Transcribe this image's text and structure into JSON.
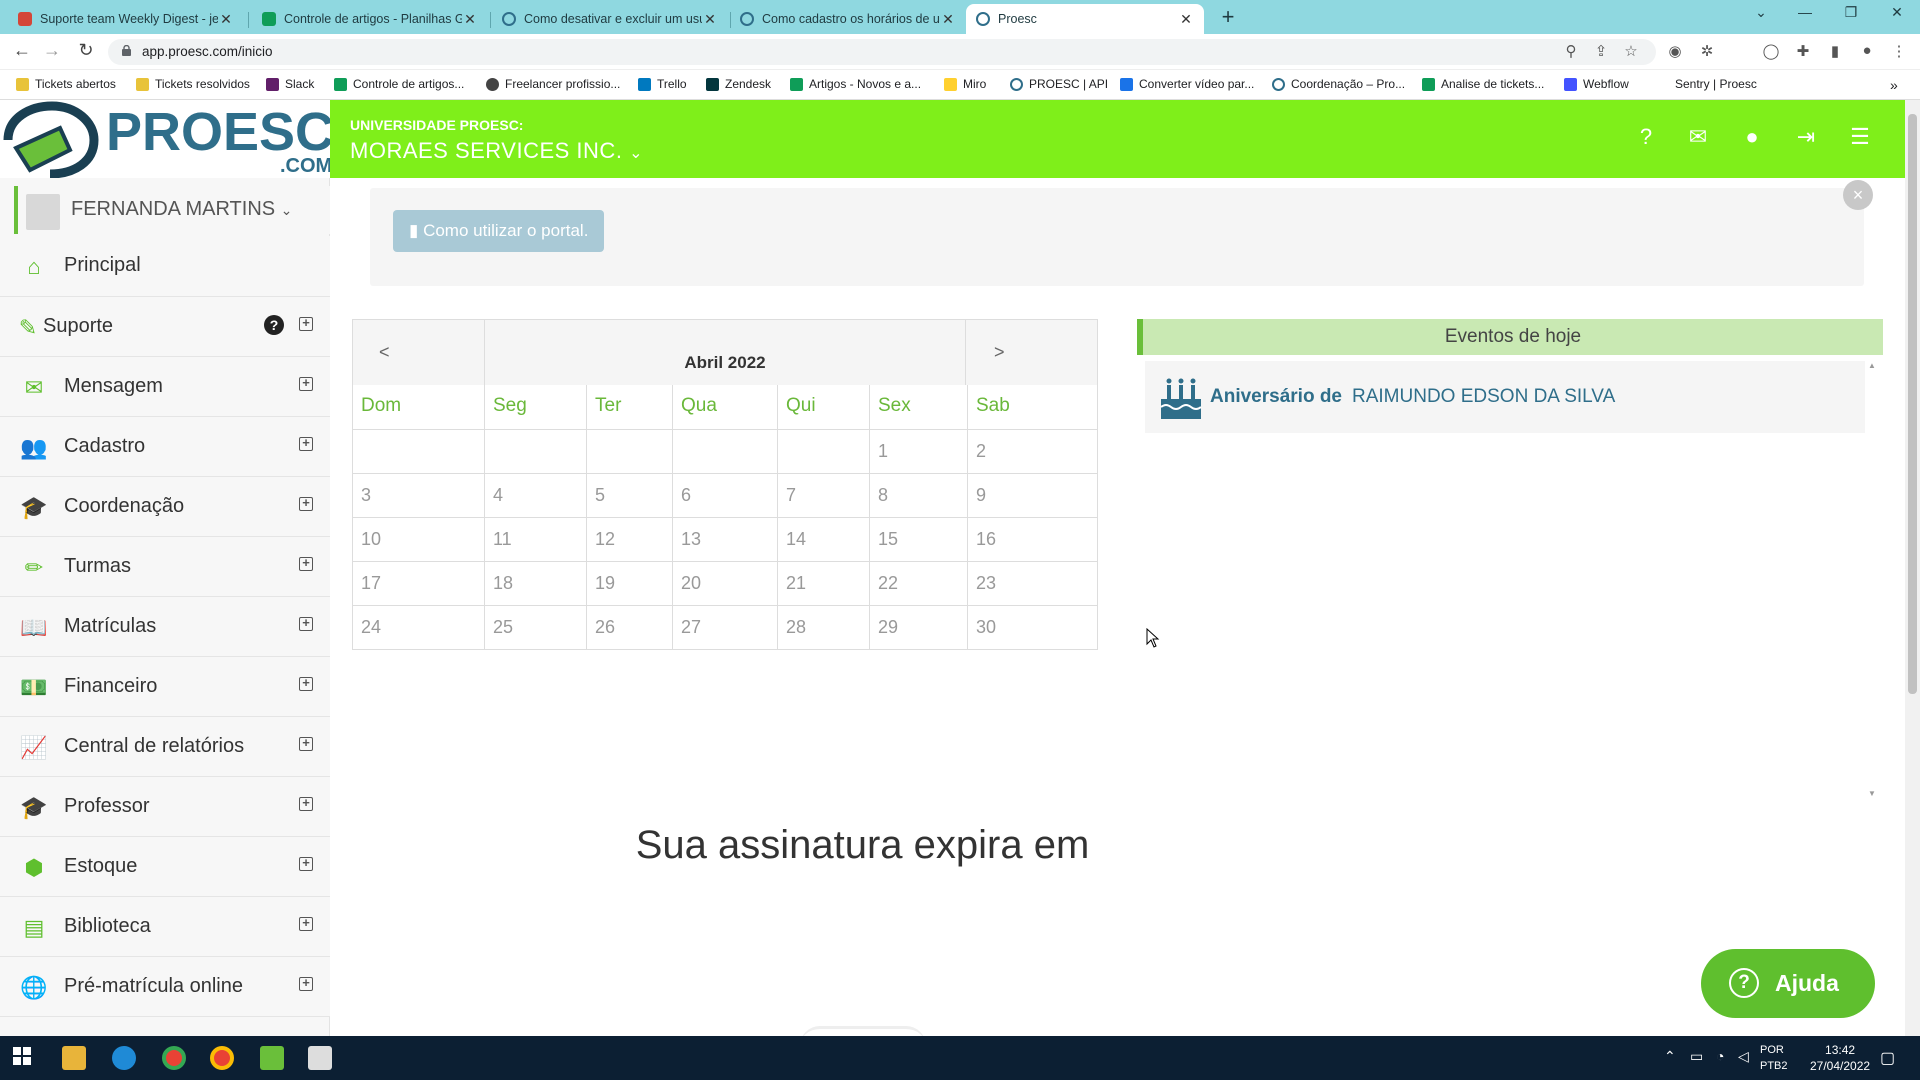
{
  "browser": {
    "tabs": [
      {
        "title": "Suporte team Weekly Digest - je",
        "favicon": "gmail-icon",
        "color": "#d44638"
      },
      {
        "title": "Controle de artigos - Planilhas G",
        "favicon": "sheets-icon",
        "color": "#0f9d58"
      },
      {
        "title": "Como desativar e excluir um usu",
        "favicon": "proesc-icon",
        "color": "#2f6e8a"
      },
      {
        "title": "Como cadastro os horários de ur",
        "favicon": "proesc-icon",
        "color": "#2f6e8a"
      },
      {
        "title": "Proesc",
        "favicon": "proesc-icon",
        "color": "#2f6e8a",
        "active": true
      }
    ],
    "new_tab": "+",
    "url": "app.proesc.com/inicio",
    "bookmarks": [
      {
        "label": "Tickets abertos",
        "color": "#e8c33a"
      },
      {
        "label": "Tickets resolvidos",
        "color": "#e8c33a"
      },
      {
        "label": "Slack",
        "color": "#611f69"
      },
      {
        "label": "Controle de artigos...",
        "color": "#0f9d58"
      },
      {
        "label": "Freelancer profissio...",
        "color": "#444"
      },
      {
        "label": "Trello",
        "color": "#0079bf"
      },
      {
        "label": "Zendesk",
        "color": "#03363d"
      },
      {
        "label": "Artigos - Novos e a...",
        "color": "#0f9d58"
      },
      {
        "label": "Miro",
        "color": "#ffd02f"
      },
      {
        "label": "PROESC | API",
        "color": "#2f6e8a"
      },
      {
        "label": "Converter vídeo par...",
        "color": "#1a73e8"
      },
      {
        "label": "Coordenação – Pro...",
        "color": "#2f6e8a"
      },
      {
        "label": "Analise de tickets...",
        "color": "#0f9d58"
      },
      {
        "label": "Webflow",
        "color": "#4353ff"
      },
      {
        "label": "Sentry | Proesc",
        "color": "#ffffff"
      }
    ]
  },
  "header": {
    "logo_text": "PROESC",
    "logo_suffix": ".COM",
    "university_label": "UNIVERSIDADE PROESC:",
    "company": "MORAES SERVICES INC.",
    "accent": "#7fef1a"
  },
  "sidebar": {
    "user": "FERNANDA MARTINS",
    "items": [
      {
        "label": "Principal",
        "icon": "home-icon",
        "expand": false
      },
      {
        "label": "Suporte",
        "icon": "ticket-icon",
        "expand": true,
        "help": true
      },
      {
        "label": "Mensagem",
        "icon": "envelope-icon",
        "expand": true
      },
      {
        "label": "Cadastro",
        "icon": "users-icon",
        "expand": true
      },
      {
        "label": "Coordenação",
        "icon": "graduation-cap-icon",
        "expand": true
      },
      {
        "label": "Turmas",
        "icon": "pencil-icon",
        "expand": true
      },
      {
        "label": "Matrículas",
        "icon": "book-icon",
        "expand": true
      },
      {
        "label": "Financeiro",
        "icon": "money-icon",
        "expand": true
      },
      {
        "label": "Central de relatórios",
        "icon": "chart-line-icon",
        "expand": true
      },
      {
        "label": "Professor",
        "icon": "graduation-cap-icon",
        "expand": true
      },
      {
        "label": "Estoque",
        "icon": "cube-icon",
        "expand": true
      },
      {
        "label": "Biblioteca",
        "icon": "archive-icon",
        "expand": true
      },
      {
        "label": "Pré-matrícula online",
        "icon": "globe-icon",
        "expand": true
      }
    ]
  },
  "notice": {
    "button_label": "Como utilizar o portal.",
    "close": "×"
  },
  "calendar": {
    "month": "Abril 2022",
    "prev": "<",
    "next": ">",
    "weekdays": [
      "Dom",
      "Seg",
      "Ter",
      "Qua",
      "Qui",
      "Sex",
      "Sab"
    ],
    "weeks": [
      [
        "",
        "",
        "",
        "",
        "",
        "1",
        "2"
      ],
      [
        "3",
        "4",
        "5",
        "6",
        "7",
        "8",
        "9"
      ],
      [
        "10",
        "11",
        "12",
        "13",
        "14",
        "15",
        "16"
      ],
      [
        "17",
        "18",
        "19",
        "20",
        "21",
        "22",
        "23"
      ],
      [
        "24",
        "25",
        "26",
        "27",
        "28",
        "29",
        "30"
      ]
    ]
  },
  "events": {
    "heading": "Eventos de hoje",
    "items": [
      {
        "prefix": "Aniversário de",
        "name": "RAIMUNDO EDSON DA SILVA"
      }
    ]
  },
  "subscription": {
    "text": "Sua assinatura expira em"
  },
  "help_button": {
    "label": "Ajuda"
  },
  "taskbar": {
    "lang1": "POR",
    "lang2": "PTB2",
    "time": "13:42",
    "date": "27/04/2022"
  }
}
